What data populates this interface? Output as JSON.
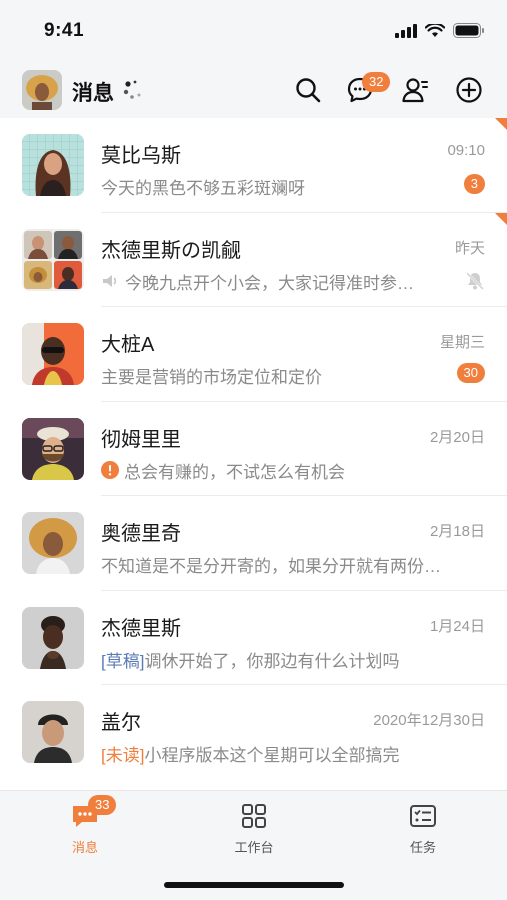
{
  "status_bar": {
    "time": "9:41"
  },
  "nav": {
    "title": "消息",
    "message_badge": "32"
  },
  "conversations": [
    {
      "name": "莫比乌斯",
      "time": "09:10",
      "preview": "今天的黑色不够五彩斑斓呀",
      "badge": "3",
      "pinned": true
    },
    {
      "name": "杰德里斯の凯觎",
      "time": "昨天",
      "preview": "今晚九点开个小会，大家记得准时参…",
      "pinned": true,
      "muted": true
    },
    {
      "name": "大桩A",
      "time": "星期三",
      "preview": "主要是营销的市场定位和定价",
      "badge": "30"
    },
    {
      "name": "彻姆里里",
      "time": "2月20日",
      "preview": "总会有赚的，不试怎么有机会",
      "error": true
    },
    {
      "name": "奥德里奇",
      "time": "2月18日",
      "preview": "不知道是不是分开寄的，如果分开就有两份…"
    },
    {
      "name": "杰德里斯",
      "time": "1月24日",
      "tag": "[草稿]",
      "preview": "调休开始了，你那边有什么计划吗"
    },
    {
      "name": "盖尔",
      "time": "2020年12月30日",
      "tag": "[未读]",
      "preview": "小程序版本这个星期可以全部搞完"
    }
  ],
  "tabs": [
    {
      "label": "消息",
      "badge": "33"
    },
    {
      "label": "工作台"
    },
    {
      "label": "任务"
    }
  ],
  "colors": {
    "accent": "#f07e3c",
    "draft": "#5b7bb3"
  }
}
